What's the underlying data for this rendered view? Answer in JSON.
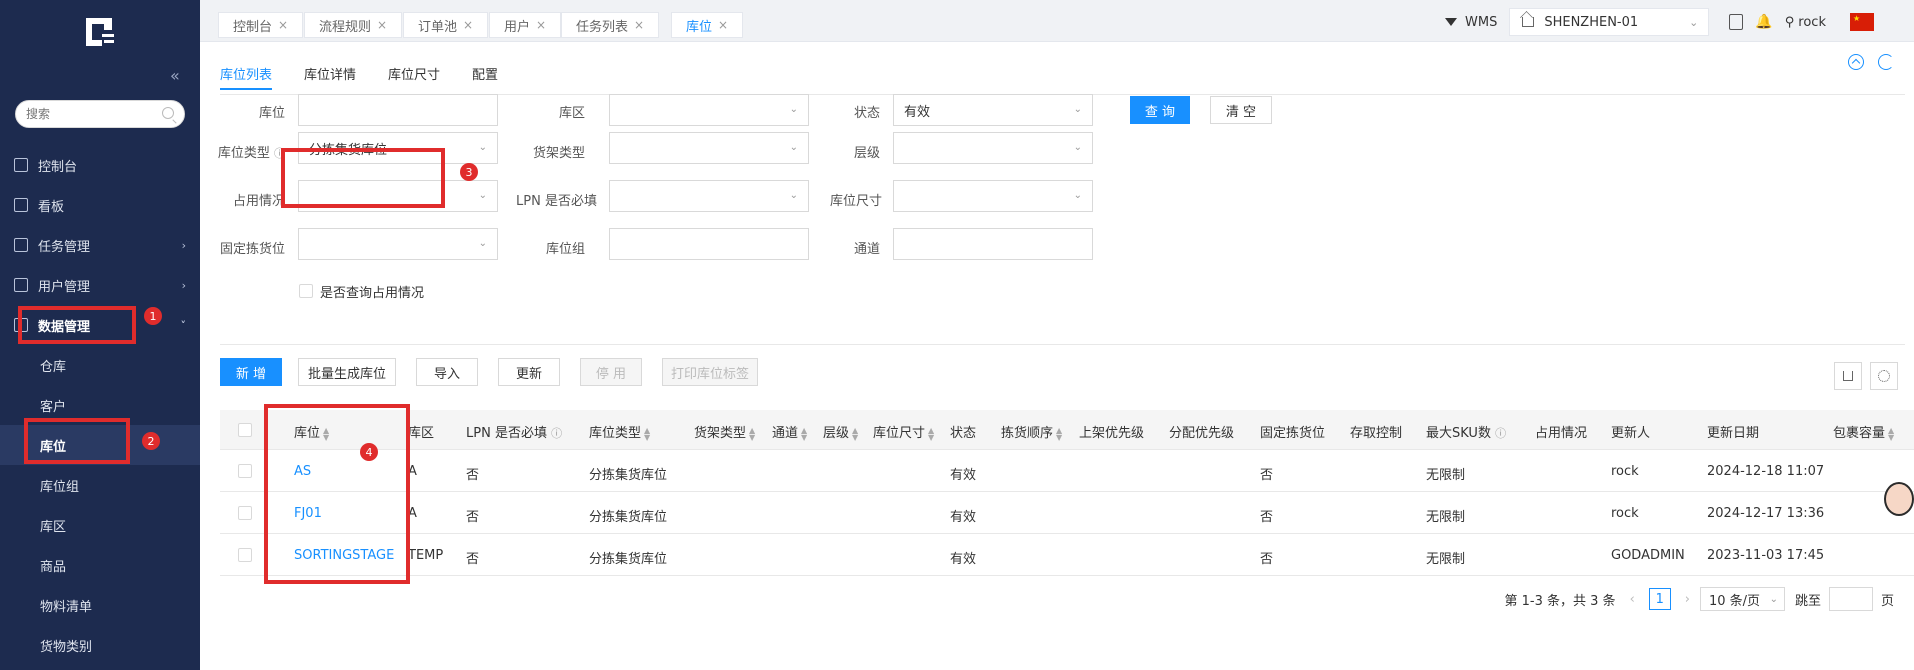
{
  "sidebar": {
    "search_placeholder": "搜索",
    "collapse_glyph": "«",
    "menu": [
      {
        "label": "控制台",
        "icon": "rocket-icon"
      },
      {
        "label": "看板",
        "icon": "bar-chart-icon"
      },
      {
        "label": "任务管理",
        "icon": "box-icon"
      },
      {
        "label": "用户管理",
        "icon": "users-icon"
      },
      {
        "label": "数据管理",
        "icon": "data-icon"
      }
    ],
    "submenu": [
      "仓库",
      "客户",
      "库位",
      "库位组",
      "库区",
      "商品",
      "物料清单",
      "货物类别"
    ]
  },
  "tabs": [
    "控制台",
    "流程规则",
    "订单池",
    "用户",
    "任务列表",
    "库位"
  ],
  "topbar": {
    "app": "WMS",
    "warehouse": "SHENZHEN-01",
    "username": "rock"
  },
  "content_tabs": [
    "库位列表",
    "库位详情",
    "库位尺寸",
    "配置"
  ],
  "filters": {
    "location_label": "库位",
    "zone_label": "库区",
    "status_label": "状态",
    "status_value": "有效",
    "type_label": "库位类型",
    "type_value": "分拣集货库位",
    "shelf_label": "货架类型",
    "level_label": "层级",
    "occupancy_label": "占用情况",
    "lpn_label": "LPN 是否必填",
    "size_label": "库位尺寸",
    "fixed_label": "固定拣货位",
    "group_label": "库位组",
    "aisle_label": "通道",
    "query_occupancy_label": "是否查询占用情况",
    "query_button": "查 询",
    "clear_button": "清 空"
  },
  "actions": {
    "add": "新 增",
    "batch": "批量生成库位",
    "import": "导入",
    "update": "更新",
    "disable": "停 用",
    "print": "打印库位标签"
  },
  "table": {
    "headers": [
      "库位",
      "库区",
      "LPN 是否必填",
      "库位类型",
      "货架类型",
      "通道",
      "层级",
      "库位尺寸",
      "状态",
      "拣货顺序",
      "上架优先级",
      "分配优先级",
      "固定拣货位",
      "存取控制",
      "最大SKU数",
      "占用情况",
      "更新人",
      "更新日期",
      "包裹容量"
    ],
    "rows": [
      {
        "location": "AS",
        "zone": "A",
        "lpn": "否",
        "type": "分拣集货库位",
        "status": "有效",
        "fixed": "否",
        "max_sku": "无限制",
        "updater": "rock",
        "date": "2024-12-18 11:07"
      },
      {
        "location": "FJ01",
        "zone": "A",
        "lpn": "否",
        "type": "分拣集货库位",
        "status": "有效",
        "fixed": "否",
        "max_sku": "无限制",
        "updater": "rock",
        "date": "2024-12-17 13:36"
      },
      {
        "location": "SORTINGSTAGE",
        "zone": "TEMP",
        "lpn": "否",
        "type": "分拣集货库位",
        "status": "有效",
        "fixed": "否",
        "max_sku": "无限制",
        "updater": "GODADMIN",
        "date": "2023-11-03 17:45"
      }
    ]
  },
  "pagination": {
    "summary": "第 1-3 条，共 3 条",
    "page": "1",
    "page_size": "10 条/页",
    "jump_label": "跳至",
    "page_unit": "页"
  },
  "annotations": [
    "1",
    "2",
    "3",
    "4"
  ],
  "colors": {
    "sidebar_bg": "#1d2b4f",
    "accent": "#1890ff",
    "annotation_red": "#e02c2c"
  }
}
